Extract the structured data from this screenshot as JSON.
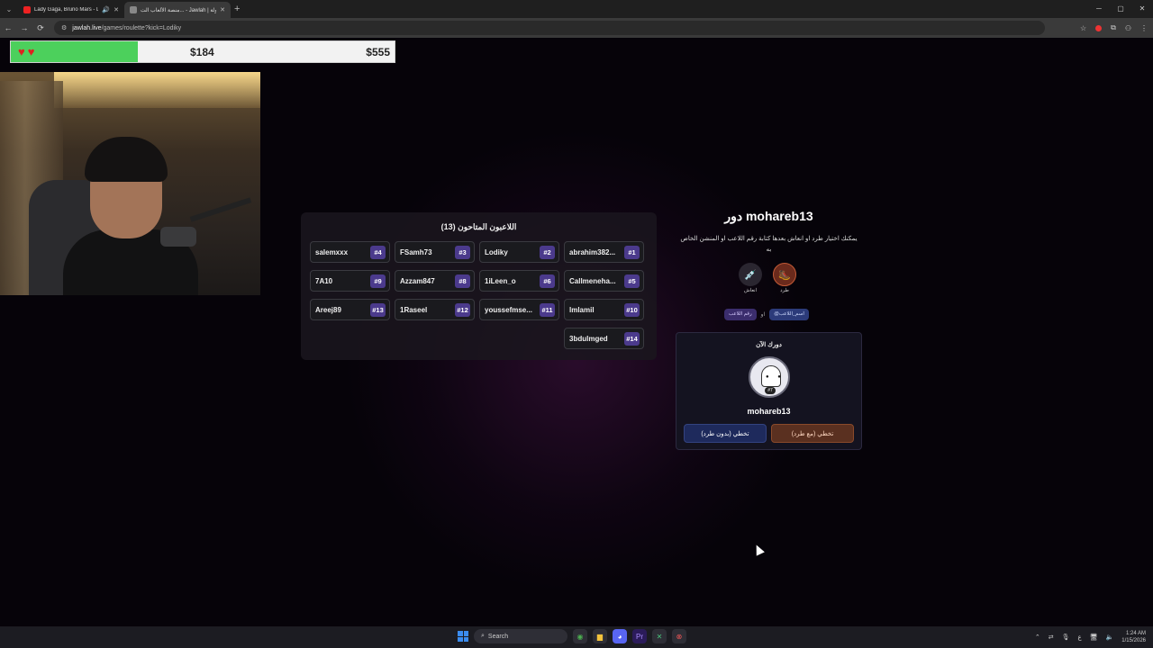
{
  "browser": {
    "tabs": [
      {
        "title": "Lady Gaga, Bruno Mars - D",
        "active": false
      },
      {
        "title": "منصة الألعاب الت... - Jawlah | جولة",
        "active": true
      }
    ],
    "url_host": "jawlah.live",
    "url_path": "/games/roulette?kick=Lodiky"
  },
  "overlay": {
    "current_money": "$184",
    "goal_money": "$555",
    "progress_fraction": 0.33,
    "hearts": [
      "♥",
      "♥"
    ]
  },
  "players_panel": {
    "title": "اللاعبون المتاحون (13)",
    "players": [
      {
        "name": "abrahim382...",
        "number": "#1"
      },
      {
        "name": "Lodiky",
        "number": "#2"
      },
      {
        "name": "FSamh73",
        "number": "#3"
      },
      {
        "name": "salemxxx",
        "number": "#4"
      },
      {
        "name": "Callmeneha...",
        "number": "#5"
      },
      {
        "name": "1iLeen_o",
        "number": "#6"
      },
      {
        "name": "Azzam847",
        "number": "#8"
      },
      {
        "name": "7A10",
        "number": "#9"
      },
      {
        "name": "lmlamil",
        "number": "#10"
      },
      {
        "name": "youssefmse...",
        "number": "#11"
      },
      {
        "name": "1Raseel",
        "number": "#12"
      },
      {
        "name": "Areej89",
        "number": "#13"
      },
      {
        "name": "3bdulmged",
        "number": "#14"
      }
    ]
  },
  "turn": {
    "title": "دور mohareb13",
    "description": "يمكنك اختيار طرد او انعاش بعدها كتابة رقم اللاعب او المنشن الخاص به",
    "actions": [
      {
        "label": "انعاش",
        "icon": "syringe-icon",
        "glyph": "💉"
      },
      {
        "label": "طرد",
        "icon": "kick-icon",
        "glyph": "🥾"
      }
    ],
    "tags": {
      "number": "رقم اللاعب",
      "or": "او",
      "mention": "@اسم_اللاعب"
    },
    "now_label": "دورك الآن",
    "player_name": "mohareb13",
    "avatar_badge": "#7",
    "skip_without_kick": "تخطي (بدون طرد)",
    "skip_with_kick": "تخطي (مع طرد)"
  },
  "taskbar": {
    "search": "Search",
    "time": "1:24 AM",
    "date": "1/15/2026",
    "lang": "ع"
  },
  "colors": {
    "accent_purple": "#4b3a8c",
    "green_fill": "#4cd05c",
    "kick_orange": "#8a4a2a"
  }
}
